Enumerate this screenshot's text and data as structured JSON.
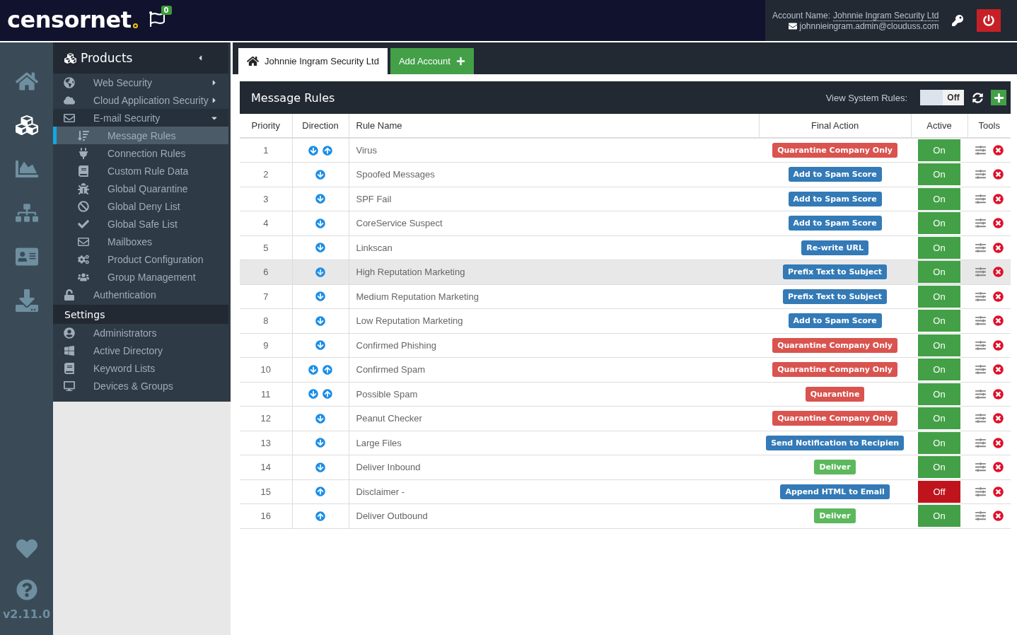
{
  "header": {
    "logo": "censornet",
    "flag_badge": "0",
    "account_label": "Account Name:",
    "account_name": "Johnnie Ingram Security Ltd",
    "email": "johnnieingram.admin@clouduss.com"
  },
  "rail": {
    "items": [
      {
        "selected": false
      },
      {
        "selected": true
      },
      {
        "selected": false
      },
      {
        "selected": false
      },
      {
        "selected": false
      },
      {
        "selected": false
      }
    ],
    "version": "v2.11.0"
  },
  "sidebar": {
    "title": "Products",
    "items": [
      {
        "label": "Web Security",
        "selected": false,
        "expanded": false
      },
      {
        "label": "Cloud Application Security",
        "selected": false,
        "expanded": false
      },
      {
        "label": "E-mail Security",
        "selected": false,
        "expanded": true,
        "children": [
          {
            "label": "Message Rules",
            "selected": true
          },
          {
            "label": "Connection Rules",
            "selected": false
          },
          {
            "label": "Custom Rule Data",
            "selected": false
          },
          {
            "label": "Global Quarantine",
            "selected": false
          },
          {
            "label": "Global Deny List",
            "selected": false
          },
          {
            "label": "Global Safe List",
            "selected": false
          },
          {
            "label": "Mailboxes",
            "selected": false
          },
          {
            "label": "Product Configuration",
            "selected": false
          },
          {
            "label": "Group Management",
            "selected": false
          }
        ]
      },
      {
        "label": "Authentication",
        "selected": false
      }
    ],
    "settings_title": "Settings",
    "settings_items": [
      {
        "label": "Administrators",
        "selected": false
      },
      {
        "label": "Active Directory",
        "selected": false
      },
      {
        "label": "Keyword Lists",
        "selected": false
      },
      {
        "label": "Devices & Groups",
        "selected": false
      }
    ]
  },
  "tabs": [
    {
      "label": "Johnnie Ingram Security Ltd",
      "selected": true
    },
    {
      "label": "Add Account",
      "selected": false
    }
  ],
  "panel": {
    "title": "Message Rules",
    "system_rules_label": "View System Rules:",
    "system_rules_toggle": "Off",
    "system_rules_on": false
  },
  "table": {
    "columns": [
      "Priority",
      "Direction",
      "Rule Name",
      "Final Action",
      "Active",
      "Tools"
    ],
    "rows": [
      {
        "priority": "1",
        "inbound": true,
        "outbound": true,
        "name": "Virus",
        "action": "Quarantine Company Only",
        "color": "#d9534f",
        "active": "On",
        "on": true,
        "selected": false
      },
      {
        "priority": "2",
        "inbound": true,
        "outbound": false,
        "name": "Spoofed Messages",
        "action": "Add to Spam Score",
        "color": "#337ab7",
        "active": "On",
        "on": true,
        "selected": false
      },
      {
        "priority": "3",
        "inbound": true,
        "outbound": false,
        "name": "SPF Fail",
        "action": "Add to Spam Score",
        "color": "#337ab7",
        "active": "On",
        "on": true,
        "selected": false
      },
      {
        "priority": "4",
        "inbound": true,
        "outbound": false,
        "name": "CoreService Suspect",
        "action": "Add to Spam Score",
        "color": "#337ab7",
        "active": "On",
        "on": true,
        "selected": false
      },
      {
        "priority": "5",
        "inbound": true,
        "outbound": false,
        "name": "Linkscan",
        "action": "Re-write URL",
        "color": "#337ab7",
        "active": "On",
        "on": true,
        "selected": false
      },
      {
        "priority": "6",
        "inbound": true,
        "outbound": false,
        "name": "High Reputation Marketing",
        "action": "Prefix Text to Subject",
        "color": "#337ab7",
        "active": "On",
        "on": true,
        "selected": true
      },
      {
        "priority": "7",
        "inbound": true,
        "outbound": false,
        "name": "Medium Reputation Marketing",
        "action": "Prefix Text to Subject",
        "color": "#337ab7",
        "active": "On",
        "on": true,
        "selected": false
      },
      {
        "priority": "8",
        "inbound": true,
        "outbound": false,
        "name": "Low Reputation Marketing",
        "action": "Add to Spam Score",
        "color": "#337ab7",
        "active": "On",
        "on": true,
        "selected": false
      },
      {
        "priority": "9",
        "inbound": true,
        "outbound": false,
        "name": "Confirmed Phishing",
        "action": "Quarantine Company Only",
        "color": "#d9534f",
        "active": "On",
        "on": true,
        "selected": false
      },
      {
        "priority": "10",
        "inbound": true,
        "outbound": true,
        "name": "Confirmed Spam",
        "action": "Quarantine Company Only",
        "color": "#d9534f",
        "active": "On",
        "on": true,
        "selected": false
      },
      {
        "priority": "11",
        "inbound": true,
        "outbound": true,
        "name": "Possible Spam",
        "action": "Quarantine",
        "color": "#d9534f",
        "active": "On",
        "on": true,
        "selected": false
      },
      {
        "priority": "12",
        "inbound": true,
        "outbound": false,
        "name": "Peanut Checker",
        "action": "Quarantine Company Only",
        "color": "#d9534f",
        "active": "On",
        "on": true,
        "selected": false
      },
      {
        "priority": "13",
        "inbound": true,
        "outbound": false,
        "name": "Large Files",
        "action": "Send Notification to Recipien",
        "color": "#337ab7",
        "active": "On",
        "on": true,
        "selected": false
      },
      {
        "priority": "14",
        "inbound": true,
        "outbound": false,
        "name": "Deliver Inbound",
        "action": "Deliver",
        "color": "#5cb85c",
        "active": "On",
        "on": true,
        "selected": false
      },
      {
        "priority": "15",
        "inbound": false,
        "outbound": true,
        "name": "Disclaimer -",
        "action": "Append HTML to Email",
        "color": "#337ab7",
        "active": "Off",
        "on": false,
        "selected": false
      },
      {
        "priority": "16",
        "inbound": false,
        "outbound": true,
        "name": "Deliver Outbound",
        "action": "Deliver",
        "color": "#5cb85c",
        "active": "On",
        "on": true,
        "selected": false
      }
    ]
  }
}
